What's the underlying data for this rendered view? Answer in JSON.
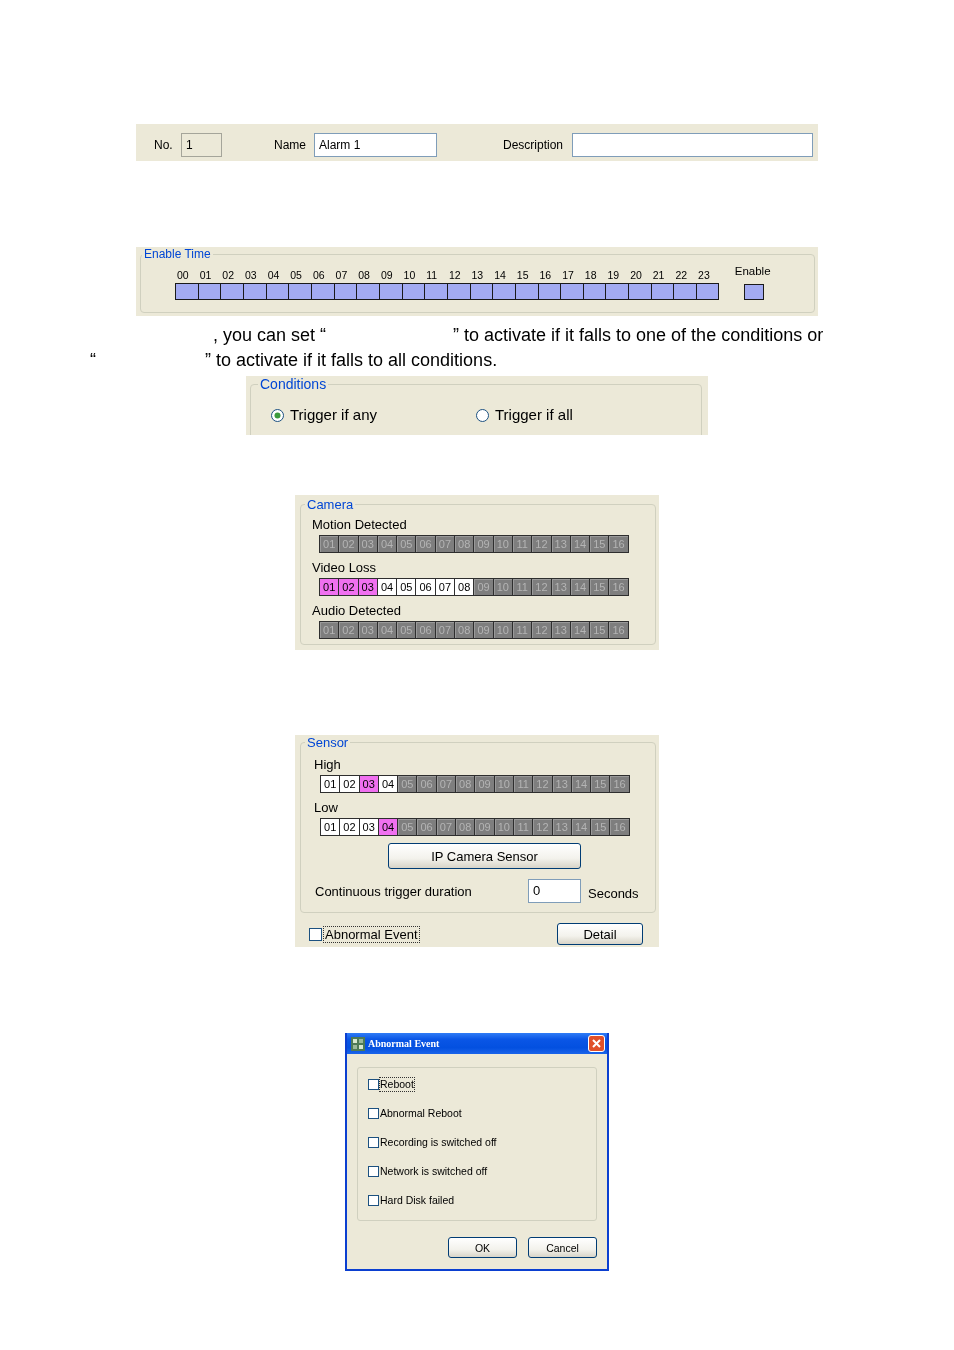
{
  "alarm": {
    "no_label": "No.",
    "no_value": "1",
    "name_label": "Name",
    "name_value": "Alarm 1",
    "description_label": "Description"
  },
  "enable_time": {
    "title": "Enable Time",
    "hours": [
      {
        "label": "00",
        "on": true
      },
      {
        "label": "01",
        "on": true
      },
      {
        "label": "02",
        "on": true
      },
      {
        "label": "03",
        "on": true
      },
      {
        "label": "04",
        "on": true
      },
      {
        "label": "05",
        "on": true
      },
      {
        "label": "06",
        "on": true
      },
      {
        "label": "07",
        "on": true
      },
      {
        "label": "08",
        "on": true
      },
      {
        "label": "09",
        "on": true
      },
      {
        "label": "10",
        "on": true
      },
      {
        "label": "11",
        "on": true
      },
      {
        "label": "12",
        "on": true
      },
      {
        "label": "13",
        "on": true
      },
      {
        "label": "14",
        "on": true
      },
      {
        "label": "15",
        "on": true
      },
      {
        "label": "16",
        "on": true
      },
      {
        "label": "17",
        "on": true
      },
      {
        "label": "18",
        "on": true
      },
      {
        "label": "19",
        "on": true
      },
      {
        "label": "20",
        "on": true
      },
      {
        "label": "21",
        "on": true
      },
      {
        "label": "22",
        "on": true
      },
      {
        "label": "23",
        "on": true
      }
    ],
    "enable_label": "Enable",
    "enable_on": true
  },
  "paragraph": {
    "lines": [
      {
        "segments": [
          ", you can set “",
          "” to activate if it falls to one of the conditions or"
        ]
      },
      {
        "segments": [
          "“",
          "” to activate if it falls to all conditions."
        ]
      }
    ]
  },
  "conditions": {
    "title": "Conditions",
    "options": [
      {
        "label": "Trigger if any",
        "selected": true
      },
      {
        "label": "Trigger if all",
        "selected": false
      }
    ]
  },
  "camera": {
    "title": "Camera",
    "rows": [
      {
        "label": "Motion Detected",
        "channels": [
          {
            "label": "01",
            "disabled": true,
            "selected": false
          },
          {
            "label": "02",
            "disabled": true,
            "selected": false
          },
          {
            "label": "03",
            "disabled": true,
            "selected": false
          },
          {
            "label": "04",
            "disabled": true,
            "selected": false
          },
          {
            "label": "05",
            "disabled": true,
            "selected": false
          },
          {
            "label": "06",
            "disabled": true,
            "selected": false
          },
          {
            "label": "07",
            "disabled": true,
            "selected": false
          },
          {
            "label": "08",
            "disabled": true,
            "selected": false
          },
          {
            "label": "09",
            "disabled": true,
            "selected": false
          },
          {
            "label": "10",
            "disabled": true,
            "selected": false
          },
          {
            "label": "11",
            "disabled": true,
            "selected": false
          },
          {
            "label": "12",
            "disabled": true,
            "selected": false
          },
          {
            "label": "13",
            "disabled": true,
            "selected": false
          },
          {
            "label": "14",
            "disabled": true,
            "selected": false
          },
          {
            "label": "15",
            "disabled": true,
            "selected": false
          },
          {
            "label": "16",
            "disabled": true,
            "selected": false
          }
        ]
      },
      {
        "label": "Video Loss",
        "channels": [
          {
            "label": "01",
            "disabled": false,
            "selected": true
          },
          {
            "label": "02",
            "disabled": false,
            "selected": true
          },
          {
            "label": "03",
            "disabled": false,
            "selected": true
          },
          {
            "label": "04",
            "disabled": false,
            "selected": false
          },
          {
            "label": "05",
            "disabled": false,
            "selected": false
          },
          {
            "label": "06",
            "disabled": false,
            "selected": false
          },
          {
            "label": "07",
            "disabled": false,
            "selected": false
          },
          {
            "label": "08",
            "disabled": false,
            "selected": false
          },
          {
            "label": "09",
            "disabled": true,
            "selected": false
          },
          {
            "label": "10",
            "disabled": true,
            "selected": false
          },
          {
            "label": "11",
            "disabled": true,
            "selected": false
          },
          {
            "label": "12",
            "disabled": true,
            "selected": false
          },
          {
            "label": "13",
            "disabled": true,
            "selected": false
          },
          {
            "label": "14",
            "disabled": true,
            "selected": false
          },
          {
            "label": "15",
            "disabled": true,
            "selected": false
          },
          {
            "label": "16",
            "disabled": true,
            "selected": false
          }
        ]
      },
      {
        "label": "Audio Detected",
        "channels": [
          {
            "label": "01",
            "disabled": true,
            "selected": false
          },
          {
            "label": "02",
            "disabled": true,
            "selected": false
          },
          {
            "label": "03",
            "disabled": true,
            "selected": false
          },
          {
            "label": "04",
            "disabled": true,
            "selected": false
          },
          {
            "label": "05",
            "disabled": true,
            "selected": false
          },
          {
            "label": "06",
            "disabled": true,
            "selected": false
          },
          {
            "label": "07",
            "disabled": true,
            "selected": false
          },
          {
            "label": "08",
            "disabled": true,
            "selected": false
          },
          {
            "label": "09",
            "disabled": true,
            "selected": false
          },
          {
            "label": "10",
            "disabled": true,
            "selected": false
          },
          {
            "label": "11",
            "disabled": true,
            "selected": false
          },
          {
            "label": "12",
            "disabled": true,
            "selected": false
          },
          {
            "label": "13",
            "disabled": true,
            "selected": false
          },
          {
            "label": "14",
            "disabled": true,
            "selected": false
          },
          {
            "label": "15",
            "disabled": true,
            "selected": false
          },
          {
            "label": "16",
            "disabled": true,
            "selected": false
          }
        ]
      }
    ]
  },
  "sensor": {
    "title": "Sensor",
    "rows": [
      {
        "label": "High",
        "channels": [
          {
            "label": "01",
            "disabled": false,
            "selected": false
          },
          {
            "label": "02",
            "disabled": false,
            "selected": false
          },
          {
            "label": "03",
            "disabled": false,
            "selected": true
          },
          {
            "label": "04",
            "disabled": false,
            "selected": false
          },
          {
            "label": "05",
            "disabled": true,
            "selected": false
          },
          {
            "label": "06",
            "disabled": true,
            "selected": false
          },
          {
            "label": "07",
            "disabled": true,
            "selected": false
          },
          {
            "label": "08",
            "disabled": true,
            "selected": false
          },
          {
            "label": "09",
            "disabled": true,
            "selected": false
          },
          {
            "label": "10",
            "disabled": true,
            "selected": false
          },
          {
            "label": "11",
            "disabled": true,
            "selected": false
          },
          {
            "label": "12",
            "disabled": true,
            "selected": false
          },
          {
            "label": "13",
            "disabled": true,
            "selected": false
          },
          {
            "label": "14",
            "disabled": true,
            "selected": false
          },
          {
            "label": "15",
            "disabled": true,
            "selected": false
          },
          {
            "label": "16",
            "disabled": true,
            "selected": false
          }
        ]
      },
      {
        "label": "Low",
        "channels": [
          {
            "label": "01",
            "disabled": false,
            "selected": false
          },
          {
            "label": "02",
            "disabled": false,
            "selected": false
          },
          {
            "label": "03",
            "disabled": false,
            "selected": false
          },
          {
            "label": "04",
            "disabled": false,
            "selected": true
          },
          {
            "label": "05",
            "disabled": true,
            "selected": false
          },
          {
            "label": "06",
            "disabled": true,
            "selected": false
          },
          {
            "label": "07",
            "disabled": true,
            "selected": false
          },
          {
            "label": "08",
            "disabled": true,
            "selected": false
          },
          {
            "label": "09",
            "disabled": true,
            "selected": false
          },
          {
            "label": "10",
            "disabled": true,
            "selected": false
          },
          {
            "label": "11",
            "disabled": true,
            "selected": false
          },
          {
            "label": "12",
            "disabled": true,
            "selected": false
          },
          {
            "label": "13",
            "disabled": true,
            "selected": false
          },
          {
            "label": "14",
            "disabled": true,
            "selected": false
          },
          {
            "label": "15",
            "disabled": true,
            "selected": false
          },
          {
            "label": "16",
            "disabled": true,
            "selected": false
          }
        ]
      }
    ],
    "ip_camera_button": "IP Camera Sensor",
    "duration_label": "Continuous trigger duration",
    "duration_value": "0",
    "duration_unit": "Seconds",
    "abnormal_event": {
      "label": "Abnormal Event",
      "checked": false,
      "focused": true
    },
    "detail_button": "Detail"
  },
  "dialog": {
    "title": "Abnormal Event",
    "items": [
      {
        "label": "Reboot",
        "checked": false,
        "focused": true
      },
      {
        "label": "Abnormal Reboot",
        "checked": false,
        "focused": false
      },
      {
        "label": "Recording is switched off",
        "checked": false,
        "focused": false
      },
      {
        "label": "Network is switched off",
        "checked": false,
        "focused": false
      },
      {
        "label": "Hard Disk failed",
        "checked": false,
        "focused": false
      }
    ],
    "buttons": [
      "OK",
      "Cancel"
    ]
  }
}
